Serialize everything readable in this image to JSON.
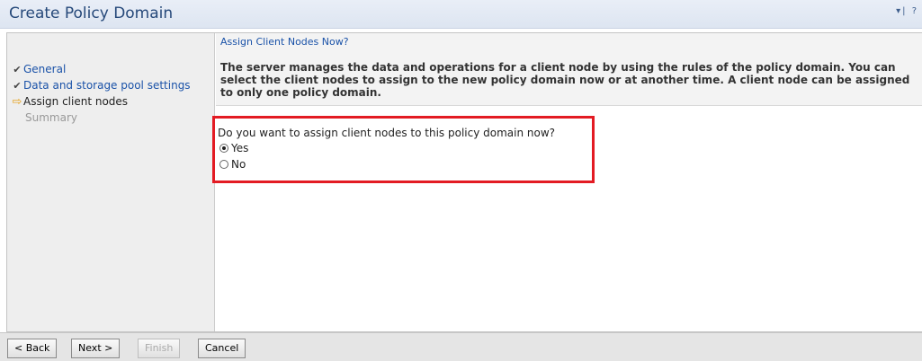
{
  "window": {
    "title": "Create Policy Domain",
    "controls": "▾| ?"
  },
  "nav": {
    "items": [
      {
        "label": "General",
        "state": "done"
      },
      {
        "label": "Data and storage pool settings",
        "state": "done"
      },
      {
        "label": "Assign client nodes",
        "state": "current"
      },
      {
        "label": "Summary",
        "state": "pending"
      }
    ]
  },
  "main": {
    "section_title": "Assign Client Nodes Now?",
    "description": "The server manages the data and operations for a client node by using the rules of the policy domain. You can select the client nodes to assign to the new policy domain now or at another time. A client node can be assigned to only one policy domain.",
    "question": "Do you want to assign client nodes to this policy domain now?",
    "options": [
      {
        "label": "Yes",
        "selected": true
      },
      {
        "label": "No",
        "selected": false
      }
    ]
  },
  "footer": {
    "back_label": "< Back",
    "next_label": "Next >",
    "finish_label": "Finish",
    "cancel_label": "Cancel"
  },
  "colors": {
    "title_text": "#26497a",
    "link_blue": "#1a52a8",
    "highlight_red": "#e31b23",
    "current_arrow": "#e5a019"
  }
}
